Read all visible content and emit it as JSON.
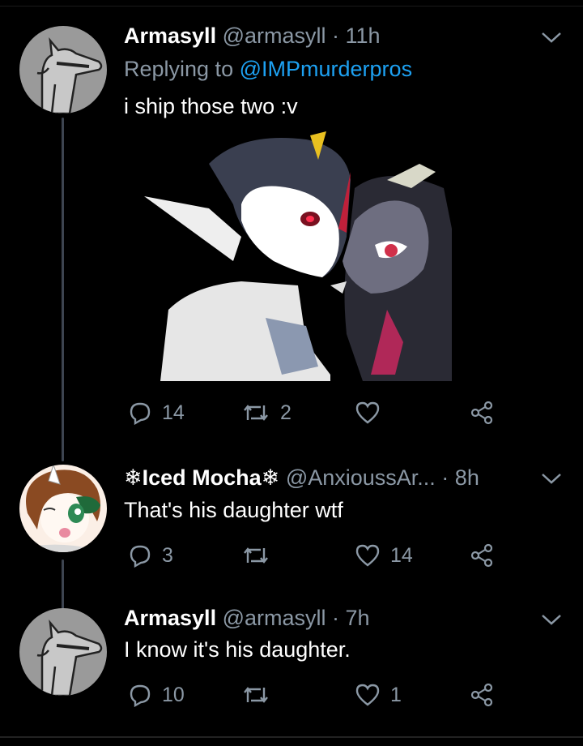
{
  "tweets": [
    {
      "name": "Armasyll",
      "handle": "@armasyll",
      "time": "11h",
      "replying_prefix": "Replying to",
      "replying_mention": "@IMPmurderpros",
      "text": "i ship those two :v",
      "replies": "14",
      "retweets": "2",
      "likes": ""
    },
    {
      "name": "❄Iced Mocha❄",
      "handle": "@AnxioussAr...",
      "time": "8h",
      "text": "That's his daughter wtf",
      "replies": "3",
      "retweets": "",
      "likes": "14"
    },
    {
      "name": "Armasyll",
      "handle": "@armasyll",
      "time": "7h",
      "text": "I know it's his daughter.",
      "replies": "10",
      "retweets": "",
      "likes": "1"
    }
  ],
  "separator": " · ",
  "colors": {
    "background": "#000000",
    "secondary_text": "#8b98a5",
    "link": "#1da1f2",
    "thread_line": "#3d4450"
  },
  "icons": [
    "reply-icon",
    "retweet-icon",
    "like-icon",
    "share-icon",
    "chevron-down-icon"
  ]
}
